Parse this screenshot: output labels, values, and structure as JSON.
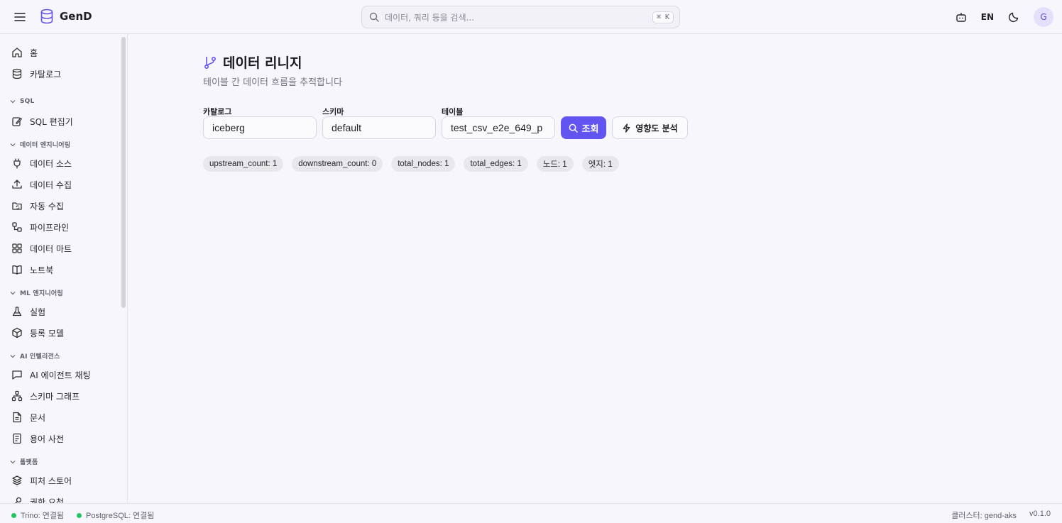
{
  "app": {
    "name": "GenD"
  },
  "header": {
    "search_placeholder": "데이터, 쿼리 등을 검색...",
    "search_shortcut": "⌘ K",
    "language": "EN",
    "avatar_initial": "G"
  },
  "sidebar": {
    "items": [
      {
        "label": "홈",
        "icon": "home-icon"
      },
      {
        "label": "카탈로그",
        "icon": "database-icon"
      }
    ],
    "sections": [
      {
        "title": "SQL",
        "items": [
          {
            "label": "SQL 편집기",
            "icon": "edit-icon"
          }
        ]
      },
      {
        "title": "데이터 엔지니어링",
        "items": [
          {
            "label": "데이터 소스",
            "icon": "plug-icon"
          },
          {
            "label": "데이터 수집",
            "icon": "upload-icon"
          },
          {
            "label": "자동 수집",
            "icon": "folder-sync-icon"
          },
          {
            "label": "파이프라인",
            "icon": "workflow-icon"
          },
          {
            "label": "데이터 마트",
            "icon": "grid-icon"
          },
          {
            "label": "노트북",
            "icon": "book-icon"
          }
        ]
      },
      {
        "title": "ML 엔지니어링",
        "items": [
          {
            "label": "실험",
            "icon": "flask-icon"
          },
          {
            "label": "등록 모델",
            "icon": "package-icon"
          }
        ]
      },
      {
        "title": "AI 인텔리전스",
        "items": [
          {
            "label": "AI 에이전트 채팅",
            "icon": "chat-icon"
          },
          {
            "label": "스키마 그래프",
            "icon": "network-icon"
          },
          {
            "label": "문서",
            "icon": "document-icon"
          },
          {
            "label": "용어 사전",
            "icon": "glossary-icon"
          }
        ]
      },
      {
        "title": "플랫폼",
        "items": [
          {
            "label": "피처 스토어",
            "icon": "layers-icon"
          },
          {
            "label": "권한 요청",
            "icon": "key-icon"
          }
        ]
      }
    ]
  },
  "page": {
    "title": "데이터 리니지",
    "subtitle": "테이블 간 데이터 흐름을 추적합니다",
    "fields": {
      "catalog": {
        "label": "카탈로그",
        "value": "iceberg"
      },
      "schema": {
        "label": "스키마",
        "value": "default"
      },
      "table": {
        "label": "테이블",
        "value": "test_csv_e2e_649_p"
      }
    },
    "search_button": "조회",
    "impact_button": "영향도 분석",
    "chips": [
      "upstream_count: 1",
      "downstream_count: 0",
      "total_nodes: 1",
      "total_edges: 1",
      "노드: 1",
      "엣지: 1"
    ]
  },
  "footer": {
    "trino": "Trino: 연결됨",
    "postgres": "PostgreSQL: 연결됨",
    "cluster": "클러스터: gend-aks",
    "version": "v0.1.0"
  },
  "colors": {
    "accent": "#6254f0",
    "status_ok": "#22c55e"
  }
}
